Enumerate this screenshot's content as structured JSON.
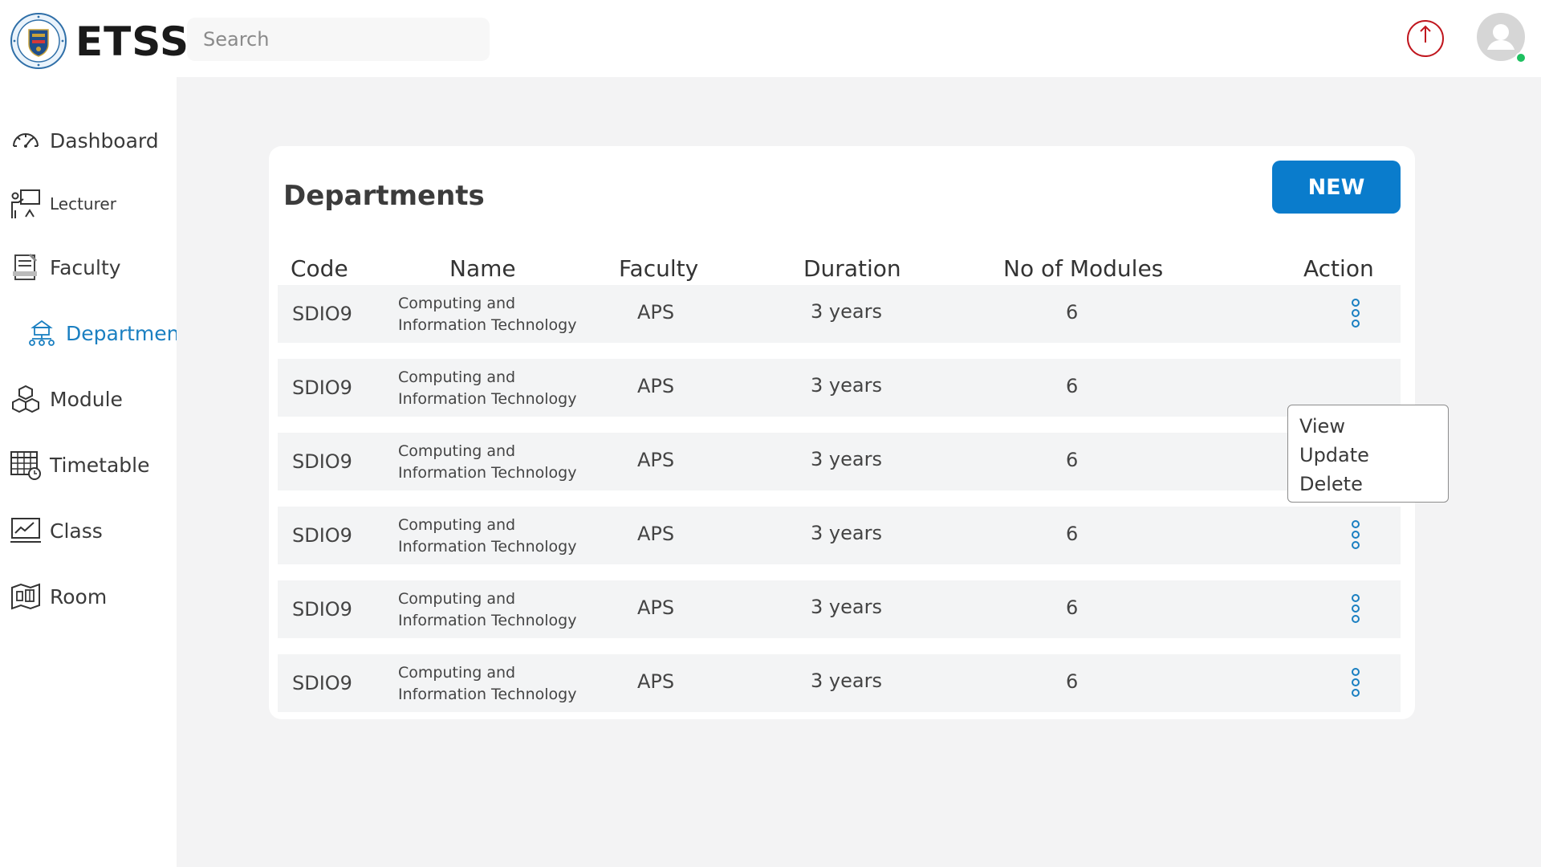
{
  "app": {
    "title": "ETSS"
  },
  "search": {
    "placeholder": "Search"
  },
  "colors": {
    "accent": "#0a7ccc",
    "active_nav": "#1a7fc1",
    "power": "#c0161e",
    "online": "#1ec060"
  },
  "sidebar": {
    "items": [
      {
        "label": "Dashboard",
        "icon": "speedometer-icon"
      },
      {
        "label": "Lecturer",
        "icon": "lecturer-board-icon"
      },
      {
        "label": "Faculty",
        "icon": "faculty-document-icon"
      },
      {
        "label": "Department",
        "icon": "department-building-icon",
        "active": true
      },
      {
        "label": "Module",
        "icon": "cubes-icon"
      },
      {
        "label": "Timetable",
        "icon": "timetable-clock-icon"
      },
      {
        "label": "Class",
        "icon": "chart-monitor-icon"
      },
      {
        "label": "Room",
        "icon": "floorplan-icon"
      }
    ]
  },
  "page": {
    "title": "Departments",
    "new_label": "NEW"
  },
  "table": {
    "columns": [
      "Code",
      "Name",
      "Faculty",
      "Duration",
      "No of Modules",
      "Action"
    ],
    "rows": [
      {
        "code": "SDIO9",
        "name": "Computing and Information Technology",
        "faculty": "APS",
        "duration": "3 years",
        "modules": "6"
      },
      {
        "code": "SDIO9",
        "name": "Computing and Information Technology",
        "faculty": "APS",
        "duration": "3 years",
        "modules": "6"
      },
      {
        "code": "SDIO9",
        "name": "Computing and Information Technology",
        "faculty": "APS",
        "duration": "3 years",
        "modules": "6"
      },
      {
        "code": "SDIO9",
        "name": "Computing and Information Technology",
        "faculty": "APS",
        "duration": "3 years",
        "modules": "6"
      },
      {
        "code": "SDIO9",
        "name": "Computing and Information Technology",
        "faculty": "APS",
        "duration": "3 years",
        "modules": "6"
      },
      {
        "code": "SDIO9",
        "name": "Computing and Information Technology",
        "faculty": "APS",
        "duration": "3 years",
        "modules": "6"
      }
    ]
  },
  "action_menu": {
    "items": [
      "View",
      "Update",
      "Delete"
    ]
  }
}
